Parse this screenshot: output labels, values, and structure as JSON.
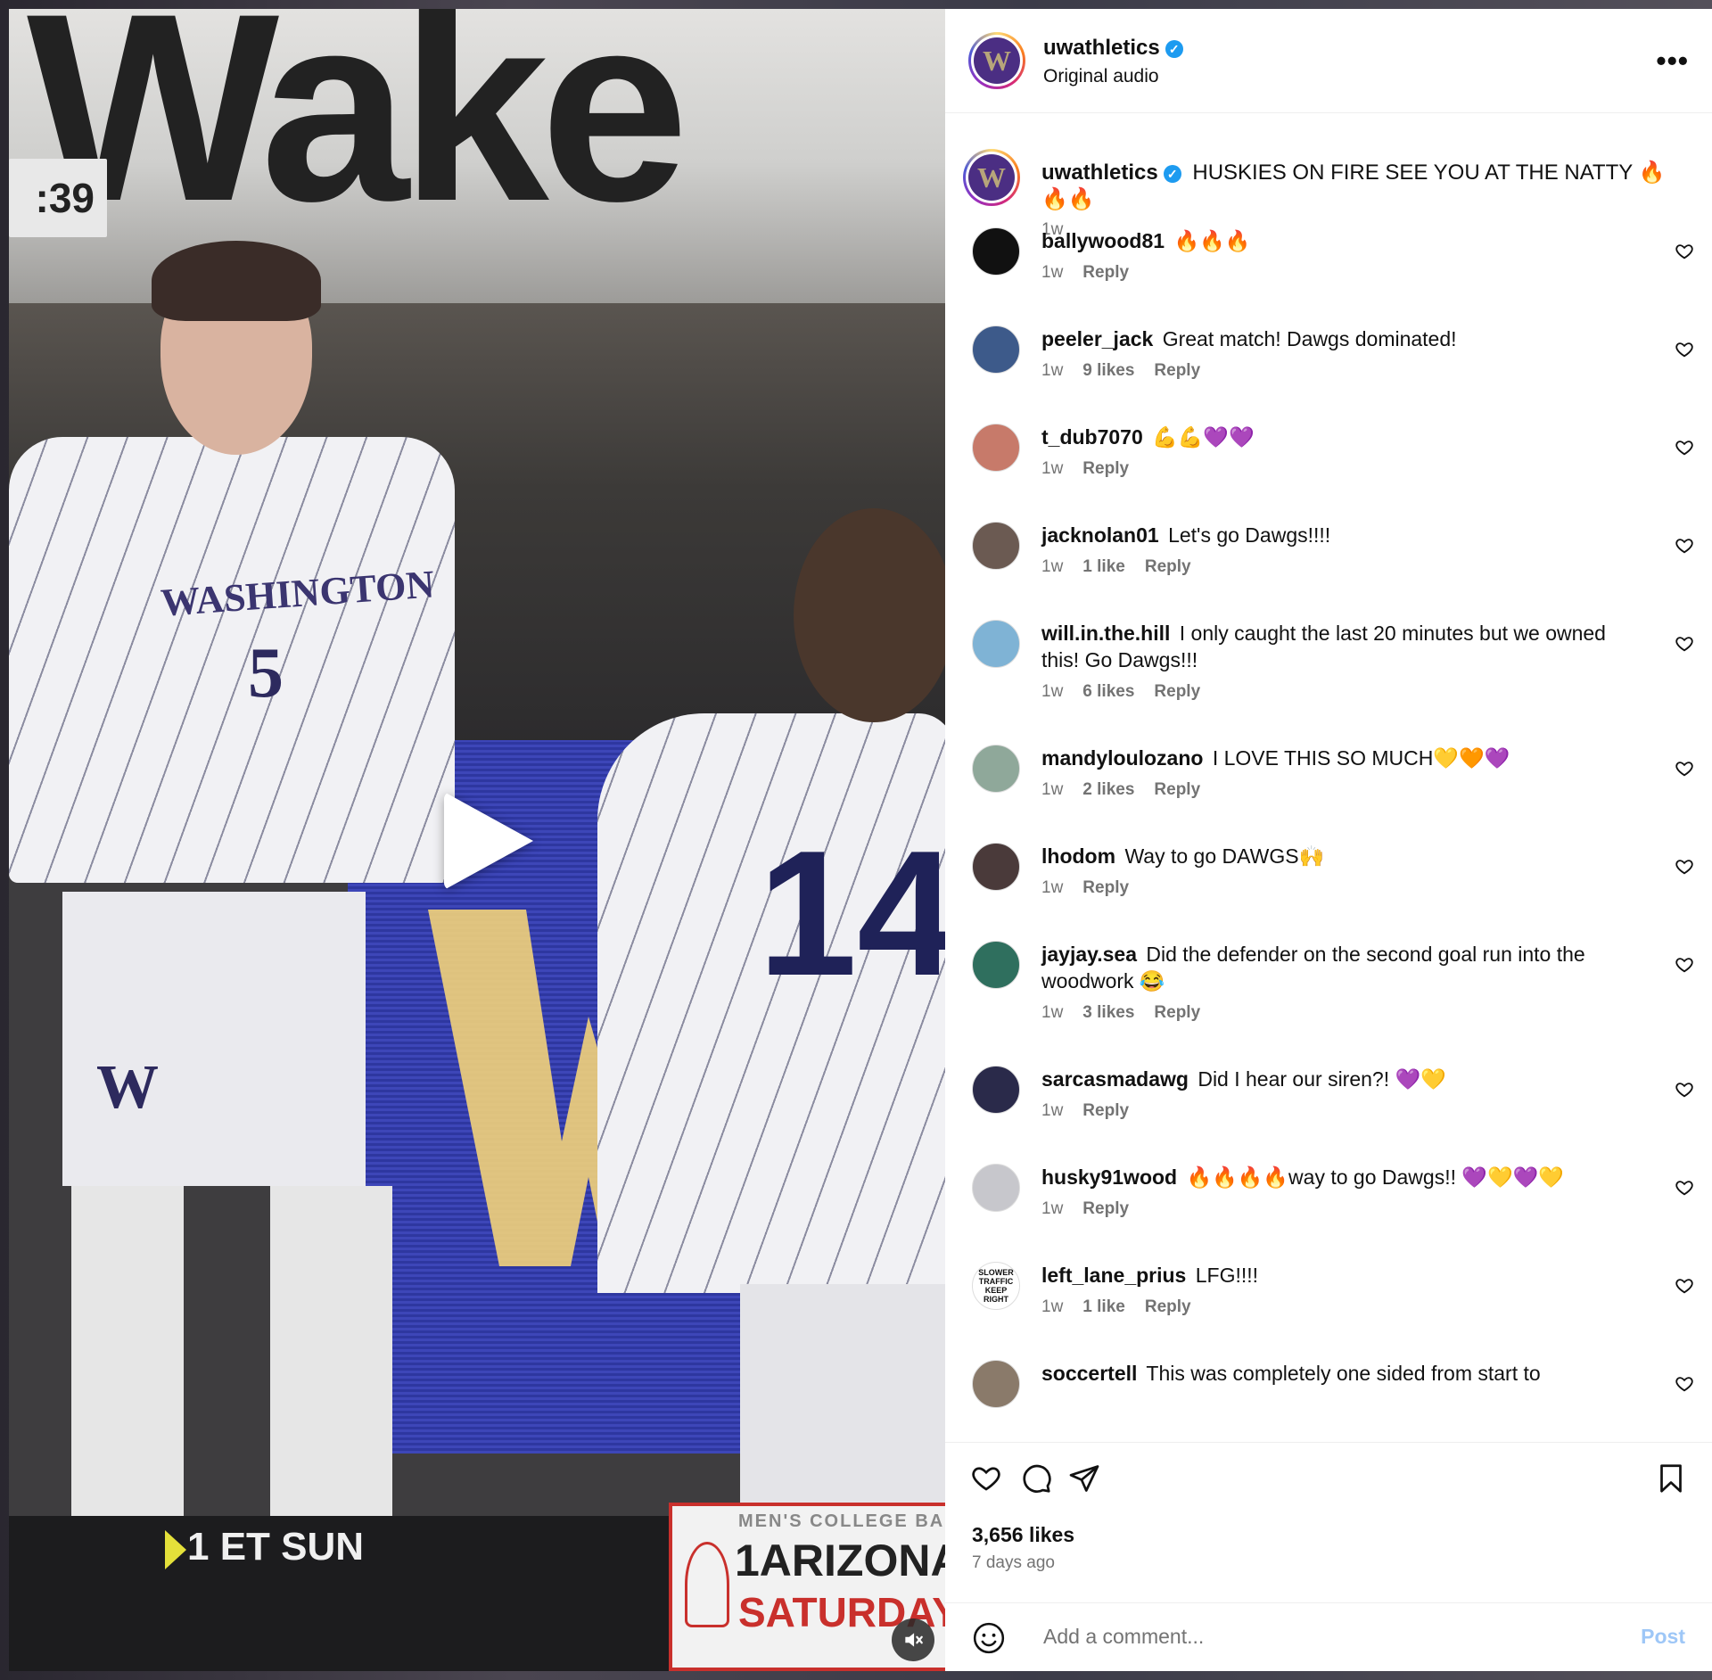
{
  "video": {
    "wall_text": "Wake",
    "scoreboard_time": ":39",
    "jersey_name": "WASHINGTON",
    "jersey_number_front": "5",
    "shorts_logo": "W",
    "jersey_number_back": "14",
    "ticker_text": "1 ET SUN",
    "promo_line1": "MEN'S COLLEGE BA",
    "promo_line2": "1ARIZONA",
    "promo_line3": "SATURDAY",
    "play_icon": "play-icon",
    "mute_icon": "muted-speaker-icon"
  },
  "post": {
    "author": "uwathletics",
    "audio": "Original audio",
    "avatar_letter": "W",
    "caption": "HUSKIES ON FIRE SEE YOU AT THE NATTY 🔥🔥🔥",
    "caption_time": "1w",
    "likes": "3,656 likes",
    "posted": "7 days ago"
  },
  "comments": [
    {
      "user": "ballywood81",
      "text": "🔥🔥🔥",
      "time": "1w",
      "likes": "",
      "reply": "Reply",
      "avatar_color": "#111111"
    },
    {
      "user": "peeler_jack",
      "text": "Great match! Dawgs dominated!",
      "time": "1w",
      "likes": "9 likes",
      "reply": "Reply",
      "avatar_color": "#3d5a8a"
    },
    {
      "user": "t_dub7070",
      "text": "💪💪💜💜",
      "time": "1w",
      "likes": "",
      "reply": "Reply",
      "avatar_color": "#c77a6a"
    },
    {
      "user": "jacknolan01",
      "text": "Let's go Dawgs!!!!",
      "time": "1w",
      "likes": "1 like",
      "reply": "Reply",
      "avatar_color": "#6b5a52"
    },
    {
      "user": "will.in.the.hill",
      "text": "I only caught the last 20 minutes but we owned this! Go Dawgs!!!",
      "time": "1w",
      "likes": "6 likes",
      "reply": "Reply",
      "avatar_color": "#7fb3d5"
    },
    {
      "user": "mandyloulozano",
      "text": "I LOVE THIS SO MUCH💛🧡💜",
      "time": "1w",
      "likes": "2 likes",
      "reply": "Reply",
      "avatar_color": "#8fa89a"
    },
    {
      "user": "lhodom",
      "text": "Way to go DAWGS🙌",
      "time": "1w",
      "likes": "",
      "reply": "Reply",
      "avatar_color": "#4a3a3a"
    },
    {
      "user": "jayjay.sea",
      "text": "Did the defender on the second goal run into the woodwork 😂",
      "time": "1w",
      "likes": "3 likes",
      "reply": "Reply",
      "avatar_color": "#2f6f5e"
    },
    {
      "user": "sarcasmadawg",
      "text": "Did I hear our siren?! 💜💛",
      "time": "1w",
      "likes": "",
      "reply": "Reply",
      "avatar_color": "#2a2a4a"
    },
    {
      "user": "husky91wood",
      "text": "🔥🔥🔥🔥way to go Dawgs!! 💜💛💜💛",
      "time": "1w",
      "likes": "",
      "reply": "Reply",
      "avatar_color": "#c7c7cc"
    },
    {
      "user": "left_lane_prius",
      "text": "LFG!!!!",
      "time": "1w",
      "likes": "1 like",
      "reply": "Reply",
      "avatar_color": "#ffffff",
      "avatar_text": "SLOWER TRAFFIC KEEP RIGHT"
    },
    {
      "user": "soccertell",
      "text": "This was completely one sided from start to",
      "time": "",
      "likes": "",
      "reply": "",
      "avatar_color": "#8a7a6a"
    }
  ],
  "add_comment": {
    "placeholder": "Add a comment...",
    "post_label": "Post"
  },
  "colors": {
    "uw_purple": "#4b2e83",
    "uw_gold": "#b7a57a",
    "verified": "#1d9bf0",
    "post_link": "#9ec7f7"
  }
}
